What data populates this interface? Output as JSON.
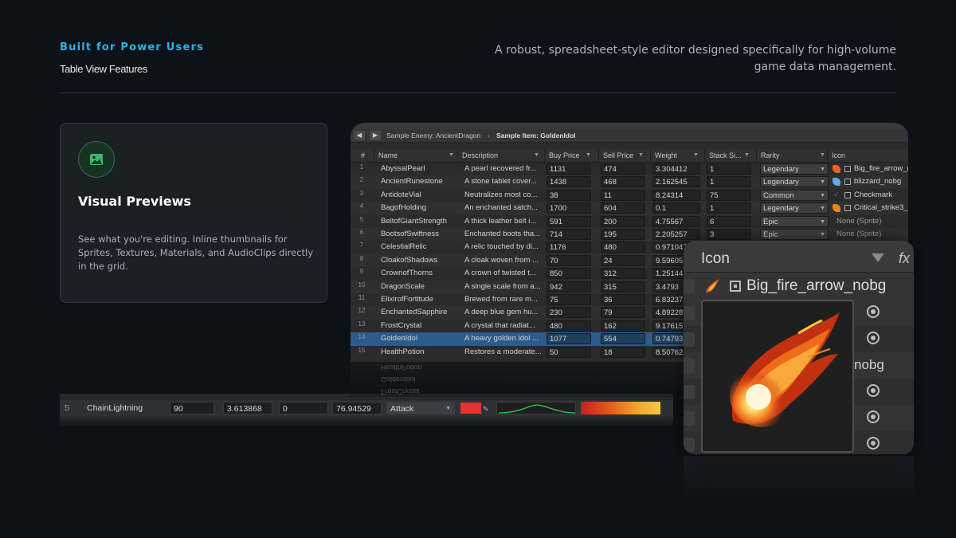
{
  "header": {
    "eyebrow": "Built for Power Users",
    "subhead": "Table View Features",
    "tagline": "A robust, spreadsheet-style editor designed specifically for high-volume game data management."
  },
  "card": {
    "icon": "image-icon",
    "title": "Visual Previews",
    "body": "See what you're editing. Inline thumbnails for Sprites, Textures, Materials, and AudioClips directly in the grid."
  },
  "colors": {
    "accent_blue": "#29b6e6",
    "accent_green": "#3fb868",
    "selected_row": "#2c5d8a"
  },
  "back_strip": {
    "row": {
      "num": "5",
      "name": "ChainLightning",
      "v1": "90",
      "v2": "3.613868",
      "v3": "0",
      "v4": "76.94529",
      "dropdown": "Attack"
    }
  },
  "editor": {
    "breadcrumb": {
      "enemy": "Sample Enemy: AncientDragon",
      "item": "Sample Item: GoldenIdol"
    },
    "columns": [
      "#",
      "Name",
      "Description",
      "Buy Price",
      "Sell Price",
      "Weight",
      "Stack Si...",
      "Rarity",
      "Icon"
    ],
    "rows": [
      {
        "n": "1",
        "name": "AbyssalPearl",
        "desc": "A pearl recovered fr...",
        "buy": "1131",
        "sell": "474",
        "weight": "3.304412",
        "stack": "1",
        "rarity": "Legendary",
        "icon": "Big_fire_arrow_n",
        "swatch": "fire"
      },
      {
        "n": "2",
        "name": "AncientRunestone",
        "desc": "A stone tablet cover...",
        "buy": "1438",
        "sell": "468",
        "weight": "2.162545",
        "stack": "1",
        "rarity": "Legendary",
        "icon": "blizzard_nobg",
        "swatch": "ice"
      },
      {
        "n": "3",
        "name": "AntidoteVial",
        "desc": "Neutralizes most co...",
        "buy": "38",
        "sell": "11",
        "weight": "8.24314",
        "stack": "75",
        "rarity": "Common",
        "icon": "Checkmark",
        "swatch": "check"
      },
      {
        "n": "4",
        "name": "BagofHolding",
        "desc": "An enchanted satch...",
        "buy": "1700",
        "sell": "604",
        "weight": "0.1",
        "stack": "1",
        "rarity": "Legendary",
        "icon": "Critical_strike3_",
        "swatch": "crit"
      },
      {
        "n": "5",
        "name": "BeltofGiantStrength",
        "desc": "A thick leather belt i...",
        "buy": "591",
        "sell": "200",
        "weight": "4.75567",
        "stack": "6",
        "rarity": "Epic",
        "icon": "None (Sprite)",
        "swatch": "none"
      },
      {
        "n": "6",
        "name": "BootsofSwiftness",
        "desc": "Enchanted boots tha...",
        "buy": "714",
        "sell": "195",
        "weight": "2.205257",
        "stack": "3",
        "rarity": "Epic",
        "icon": "None (Sprite)",
        "swatch": "none"
      },
      {
        "n": "7",
        "name": "CelestialRelic",
        "desc": "A relic touched by di...",
        "buy": "1176",
        "sell": "480",
        "weight": "0.971047",
        "stack": "",
        "rarity": "",
        "icon": "",
        "swatch": ""
      },
      {
        "n": "8",
        "name": "CloakofShadows",
        "desc": "A cloak woven from ...",
        "buy": "70",
        "sell": "24",
        "weight": "9.59605",
        "stack": "",
        "rarity": "",
        "icon": "",
        "swatch": ""
      },
      {
        "n": "9",
        "name": "CrownofThorns",
        "desc": "A crown of twisted t...",
        "buy": "850",
        "sell": "312",
        "weight": "1.25144",
        "stack": "",
        "rarity": "",
        "icon": "",
        "swatch": ""
      },
      {
        "n": "10",
        "name": "DragonScale",
        "desc": "A single scale from a...",
        "buy": "942",
        "sell": "315",
        "weight": "3.4793",
        "stack": "",
        "rarity": "",
        "icon": "",
        "swatch": ""
      },
      {
        "n": "11",
        "name": "ElixirofFortitude",
        "desc": "Brewed from rare m...",
        "buy": "75",
        "sell": "36",
        "weight": "6.83237",
        "stack": "",
        "rarity": "",
        "icon": "",
        "swatch": ""
      },
      {
        "n": "12",
        "name": "EnchantedSapphire",
        "desc": "A deep blue gem hu...",
        "buy": "230",
        "sell": "79",
        "weight": "4.89228",
        "stack": "",
        "rarity": "",
        "icon": "",
        "swatch": ""
      },
      {
        "n": "13",
        "name": "FrostCrystal",
        "desc": "A crystal that radiat...",
        "buy": "480",
        "sell": "162",
        "weight": "9.17615",
        "stack": "",
        "rarity": "",
        "icon": "",
        "swatch": ""
      },
      {
        "n": "14",
        "name": "GoldenIdol",
        "desc": "A heavy golden idol ...",
        "buy": "1077",
        "sell": "554",
        "weight": "0.74793",
        "stack": "",
        "rarity": "",
        "icon": "",
        "swatch": "",
        "active": true
      },
      {
        "n": "15",
        "name": "HealthPotion",
        "desc": "Restores a moderate...",
        "buy": "50",
        "sell": "18",
        "weight": "8.50762",
        "stack": "",
        "rarity": "",
        "icon": "",
        "swatch": ""
      }
    ]
  },
  "zoom": {
    "column_title": "Icon",
    "fx_label": "fx",
    "sprite_name": "Big_fire_arrow_nobg",
    "partial_label": "nobg"
  }
}
